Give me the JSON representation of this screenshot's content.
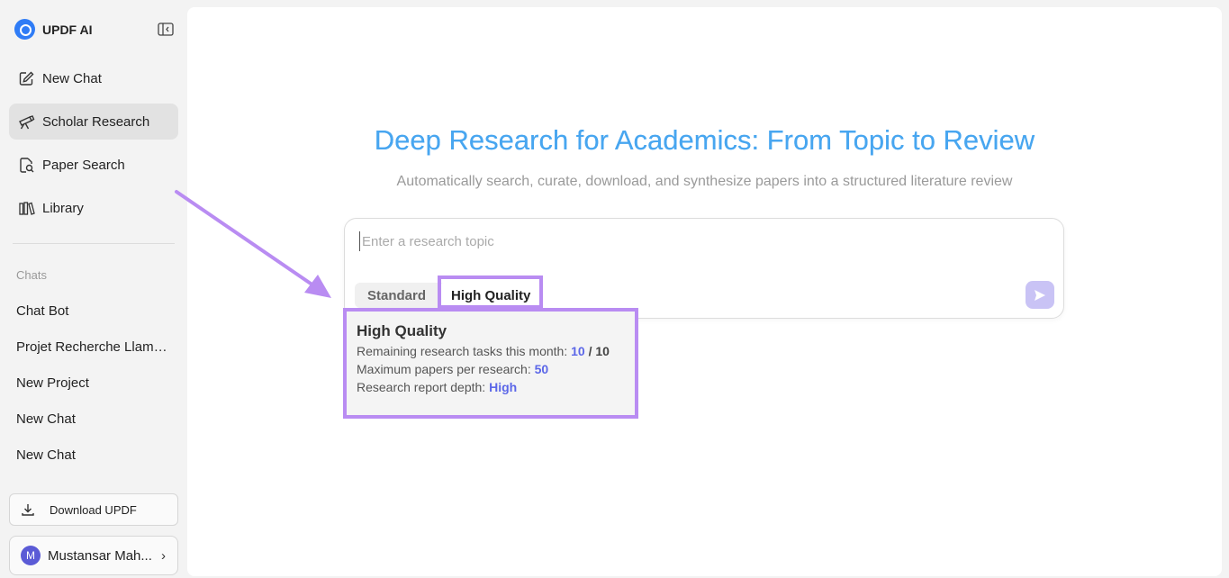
{
  "brand": {
    "name": "UPDF AI",
    "logo_icon": "updf-logo-icon"
  },
  "sidebar": {
    "nav": [
      {
        "label": "New Chat",
        "icon": "new-chat-icon"
      },
      {
        "label": "Scholar Research",
        "icon": "telescope-icon",
        "active": true
      },
      {
        "label": "Paper Search",
        "icon": "paper-search-icon"
      },
      {
        "label": "Library",
        "icon": "library-icon"
      }
    ],
    "chats_label": "Chats",
    "chats": [
      "Chat Bot",
      "Projet Recherche Llama...",
      "New Project",
      "New Chat",
      "New Chat"
    ],
    "download_label": "Download UPDF",
    "user": {
      "initial": "M",
      "name": "Mustansar Mah..."
    }
  },
  "main": {
    "title": "Deep Research for Academics: From Topic to Review",
    "subtitle": "Automatically search, curate, download, and synthesize papers into a structured literature review",
    "input_placeholder": "Enter a research topic",
    "modes": [
      "Standard",
      "High Quality"
    ],
    "selected_mode": "High Quality"
  },
  "tooltip": {
    "title": "High Quality",
    "tasks_label": "Remaining research tasks this month: ",
    "tasks_remaining": "10",
    "tasks_sep": " / ",
    "tasks_total": "10",
    "papers_label": "Maximum papers per research: ",
    "papers_value": "50",
    "depth_label": "Research report depth: ",
    "depth_value": "High"
  },
  "colors": {
    "accent": "#5c67e8",
    "highlight": "#b98cf2",
    "title_blue": "#48a6f0"
  }
}
